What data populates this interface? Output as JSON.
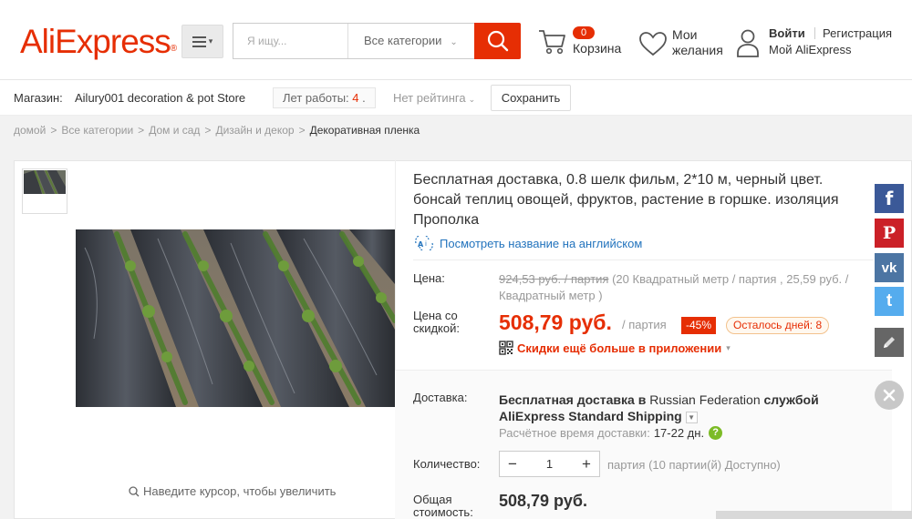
{
  "header": {
    "logo": "AliExpress",
    "logo_tm": "®",
    "search_placeholder": "Я ищу...",
    "search_category": "Все категории",
    "cart_count": "0",
    "cart_label": "Корзина",
    "wishlist_label": "Мои желания",
    "login": "Войти",
    "register": "Регистрация",
    "my_account": "Мой AliExpress"
  },
  "store": {
    "label": "Магазин:",
    "name": "Ailury001 decoration & pot Store",
    "years_label": "Лет работы:",
    "years_value": "4",
    "years_suffix": ".",
    "rating": "Нет рейтинга",
    "save_button": "Сохранить"
  },
  "breadcrumb": {
    "items": [
      "домой",
      "Все категории",
      "Дом и сад",
      "Дизайн и декор"
    ],
    "current": "Декоративная пленка",
    "separator": ">"
  },
  "gallery": {
    "zoom_hint": "Наведите курсор, чтобы увеличить"
  },
  "product": {
    "title": "Бесплатная доставка, 0.8 шелк фильм, 2*10 м, черный цвет. бонсай теплиц овощей, фруктов, растение в горшке. изоляция Прополка",
    "translate_link": "Посмотреть название на английском",
    "price_label": "Цена:",
    "old_price": "924,53 руб. / партия",
    "old_price_detail": "(20 Квадратный метр / партия , 25,59 руб. / Квадратный метр )",
    "sale_label": "Цена со скидкой:",
    "sale_price": "508,79 руб.",
    "sale_unit": "/ партия",
    "discount": "-45%",
    "days_left": "Осталось дней: 8",
    "app_promo": "Скидки ещё больше в приложении",
    "shipping_label": "Доставка:",
    "shipping_free": "Бесплатная доставка в",
    "shipping_country": "Russian Federation",
    "shipping_service": "службой AliExpress Standard Shipping",
    "shipping_time_label": "Расчётное время доставки:",
    "shipping_time_value": "17-22 дн.",
    "help_mark": "?",
    "quantity_label": "Количество:",
    "quantity_value": "1",
    "quantity_minus": "−",
    "quantity_plus": "+",
    "quantity_avail": "партия (10 партии(й) Доступно)",
    "total_label": "Общая стоимость:",
    "total_value": "508,79 руб."
  },
  "social": {
    "facebook": "f",
    "pinterest": "P",
    "vk": "vk",
    "twitter": "t"
  },
  "colors": {
    "brand": "#e62e04",
    "link": "#2273bd",
    "facebook": "#3b5998",
    "pinterest": "#cb2027",
    "vk": "#4c75a3",
    "twitter": "#55acee",
    "help": "#7cbb26"
  },
  "icons": [
    "menu-icon",
    "search-icon",
    "cart-icon",
    "heart-icon",
    "user-icon",
    "translate-icon",
    "qr-code-icon",
    "magnifier-icon",
    "facebook-icon",
    "pinterest-icon",
    "vk-icon",
    "twitter-icon",
    "pencil-icon",
    "close-icon"
  ]
}
